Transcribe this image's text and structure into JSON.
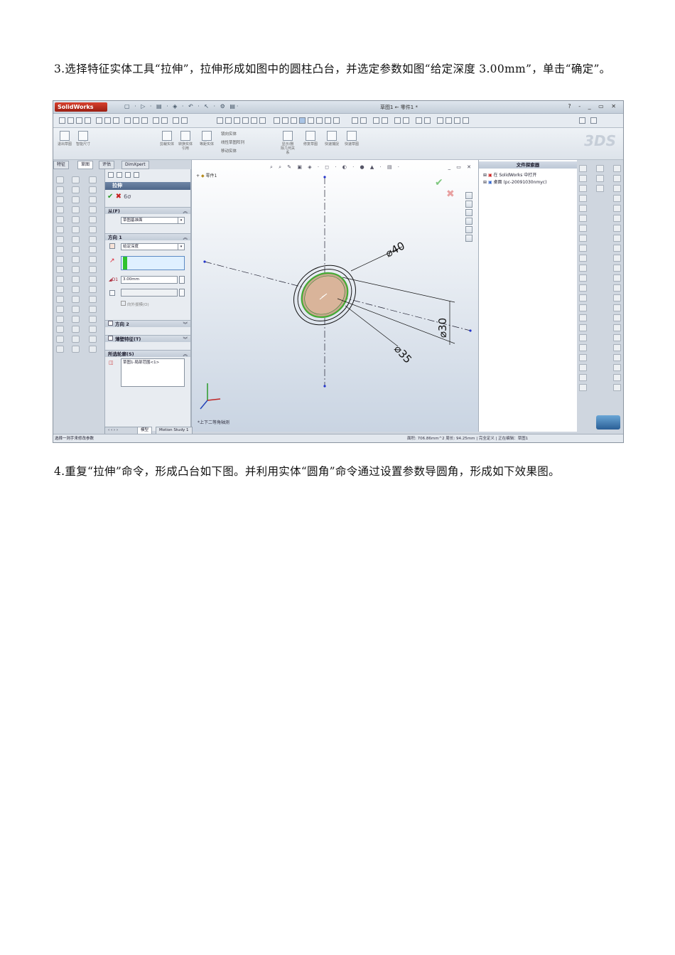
{
  "paragraph3": "3.选择特征实体工具“拉伸”，拉伸形成如图中的圆柱凸台，并选定参数如图“给定深度 3.00mm”，单击“确定”。",
  "paragraph4": "4.重复“拉伸”命令，形成凸台如下图。并利用实体“圆角”命令通过设置参数导圆角，形成如下效果图。",
  "screenshot": {
    "app_logo": "SolidWorks",
    "window_title": "草图1 ← 零件1 *",
    "window_controls": "? - _ ▭ ✕",
    "ribbon": {
      "items": [
        "退出草图",
        "智能尺寸",
        "剪裁实体",
        "转换实体引用",
        "等距实体",
        "显示/删除几何关系",
        "修复草图",
        "快速捕捉",
        "快速草图"
      ],
      "mirror_entity": "镜向实体",
      "linear_array": "线性草图阵列",
      "move_entity": "移动实体"
    },
    "tabs": [
      "特征",
      "草图",
      "评估",
      "DimXpert"
    ],
    "property_manager": {
      "title": "拉伸",
      "from_section": "从(F)",
      "from_value": "草图基准面",
      "direction1_section": "方向 1",
      "end_condition": "给定深度",
      "depth": "3.00mm",
      "merge_label": "向外拔模(O)",
      "direction2_section": "方向 2",
      "thin_feature_section": "薄壁特征(T)",
      "contours_section": "所选轮廓(S)",
      "contour_item": "草图1-局部范围<1>"
    },
    "graphics": {
      "tree_root": "零件1",
      "view_name": "*上下二等角轴测",
      "dim_40": "⌀40",
      "dim_30": "⌀30",
      "dim_35": "⌀35"
    },
    "task_pane": {
      "title": "文件探索器",
      "item1": "在 SolidWorks 中打开",
      "item2": "桌面 (pc-20091030nmyc)"
    },
    "bottom_tabs": [
      "模型",
      "Motion Study 1"
    ],
    "status": {
      "left": "选择一则手来修改参数",
      "right": "面积: 706.86mm^2 周长: 94.25mm | 完全定义 | 正在编辑：草图1"
    }
  }
}
